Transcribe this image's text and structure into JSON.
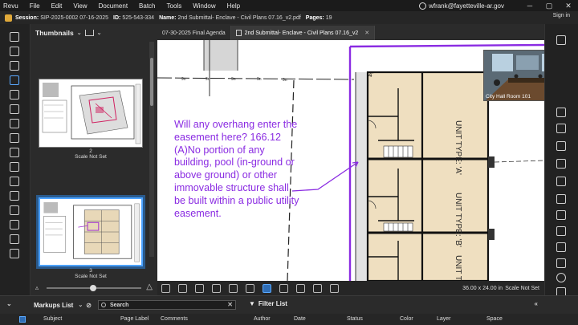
{
  "menu": [
    "Revu",
    "File",
    "Edit",
    "View",
    "Document",
    "Batch",
    "Tools",
    "Window",
    "Help"
  ],
  "user": "wfrank@fayetteville-ar.gov",
  "window_controls": [
    "─",
    "▢",
    "✕"
  ],
  "sign_in": "Sign in",
  "info": {
    "session_label": "Session:",
    "session_value": "SIP-2025-0002 07-16-2025",
    "id_label": "ID:",
    "id_value": "525-543-334",
    "name_label": "Name:",
    "name_value": "2nd Submittal- Enclave - Civil Plans 07.16_v2.pdf",
    "pages_label": "Pages:",
    "pages_value": "19"
  },
  "thumbnails": {
    "title": "Thumbnails",
    "items": [
      {
        "number": "2",
        "scale": "Scale Not Set"
      },
      {
        "number": "3",
        "scale": "Scale Not Set"
      }
    ]
  },
  "tabs": [
    {
      "label": "07-30-2025 Final Agenda"
    },
    {
      "label": "2nd Submittal- Enclave - Civil Plans 07.16_v2"
    }
  ],
  "markup_text": "Will any overhang enter the easement here? 166.12 (A)No portion of any building, pool (in-ground or above ground) or other immovable structure shall be built within a public utility easement.",
  "plan_labels": {
    "unit_a": "UNIT TYPE: 'A'",
    "unit_b": "UNIT TYPE: 'B'",
    "dim": "4'",
    "line_marks": [
      "9n",
      "9n",
      "9n",
      "9n",
      "9n"
    ]
  },
  "camera": {
    "label": "City Hall Room 101"
  },
  "status": {
    "dimensions": "36.00 x 24.00 in",
    "scale": "Scale Not Set"
  },
  "markups": {
    "title": "Markups List",
    "search_placeholder": "Search",
    "filter_label": "Filter List",
    "columns": [
      "Subject",
      "Page Label",
      "Comments",
      "Author",
      "Date",
      "Status",
      "Color",
      "Layer",
      "Space"
    ]
  },
  "colors": {
    "markup": "#8a2be2",
    "accent": "#4da3ff",
    "building": "#efdfc0"
  }
}
